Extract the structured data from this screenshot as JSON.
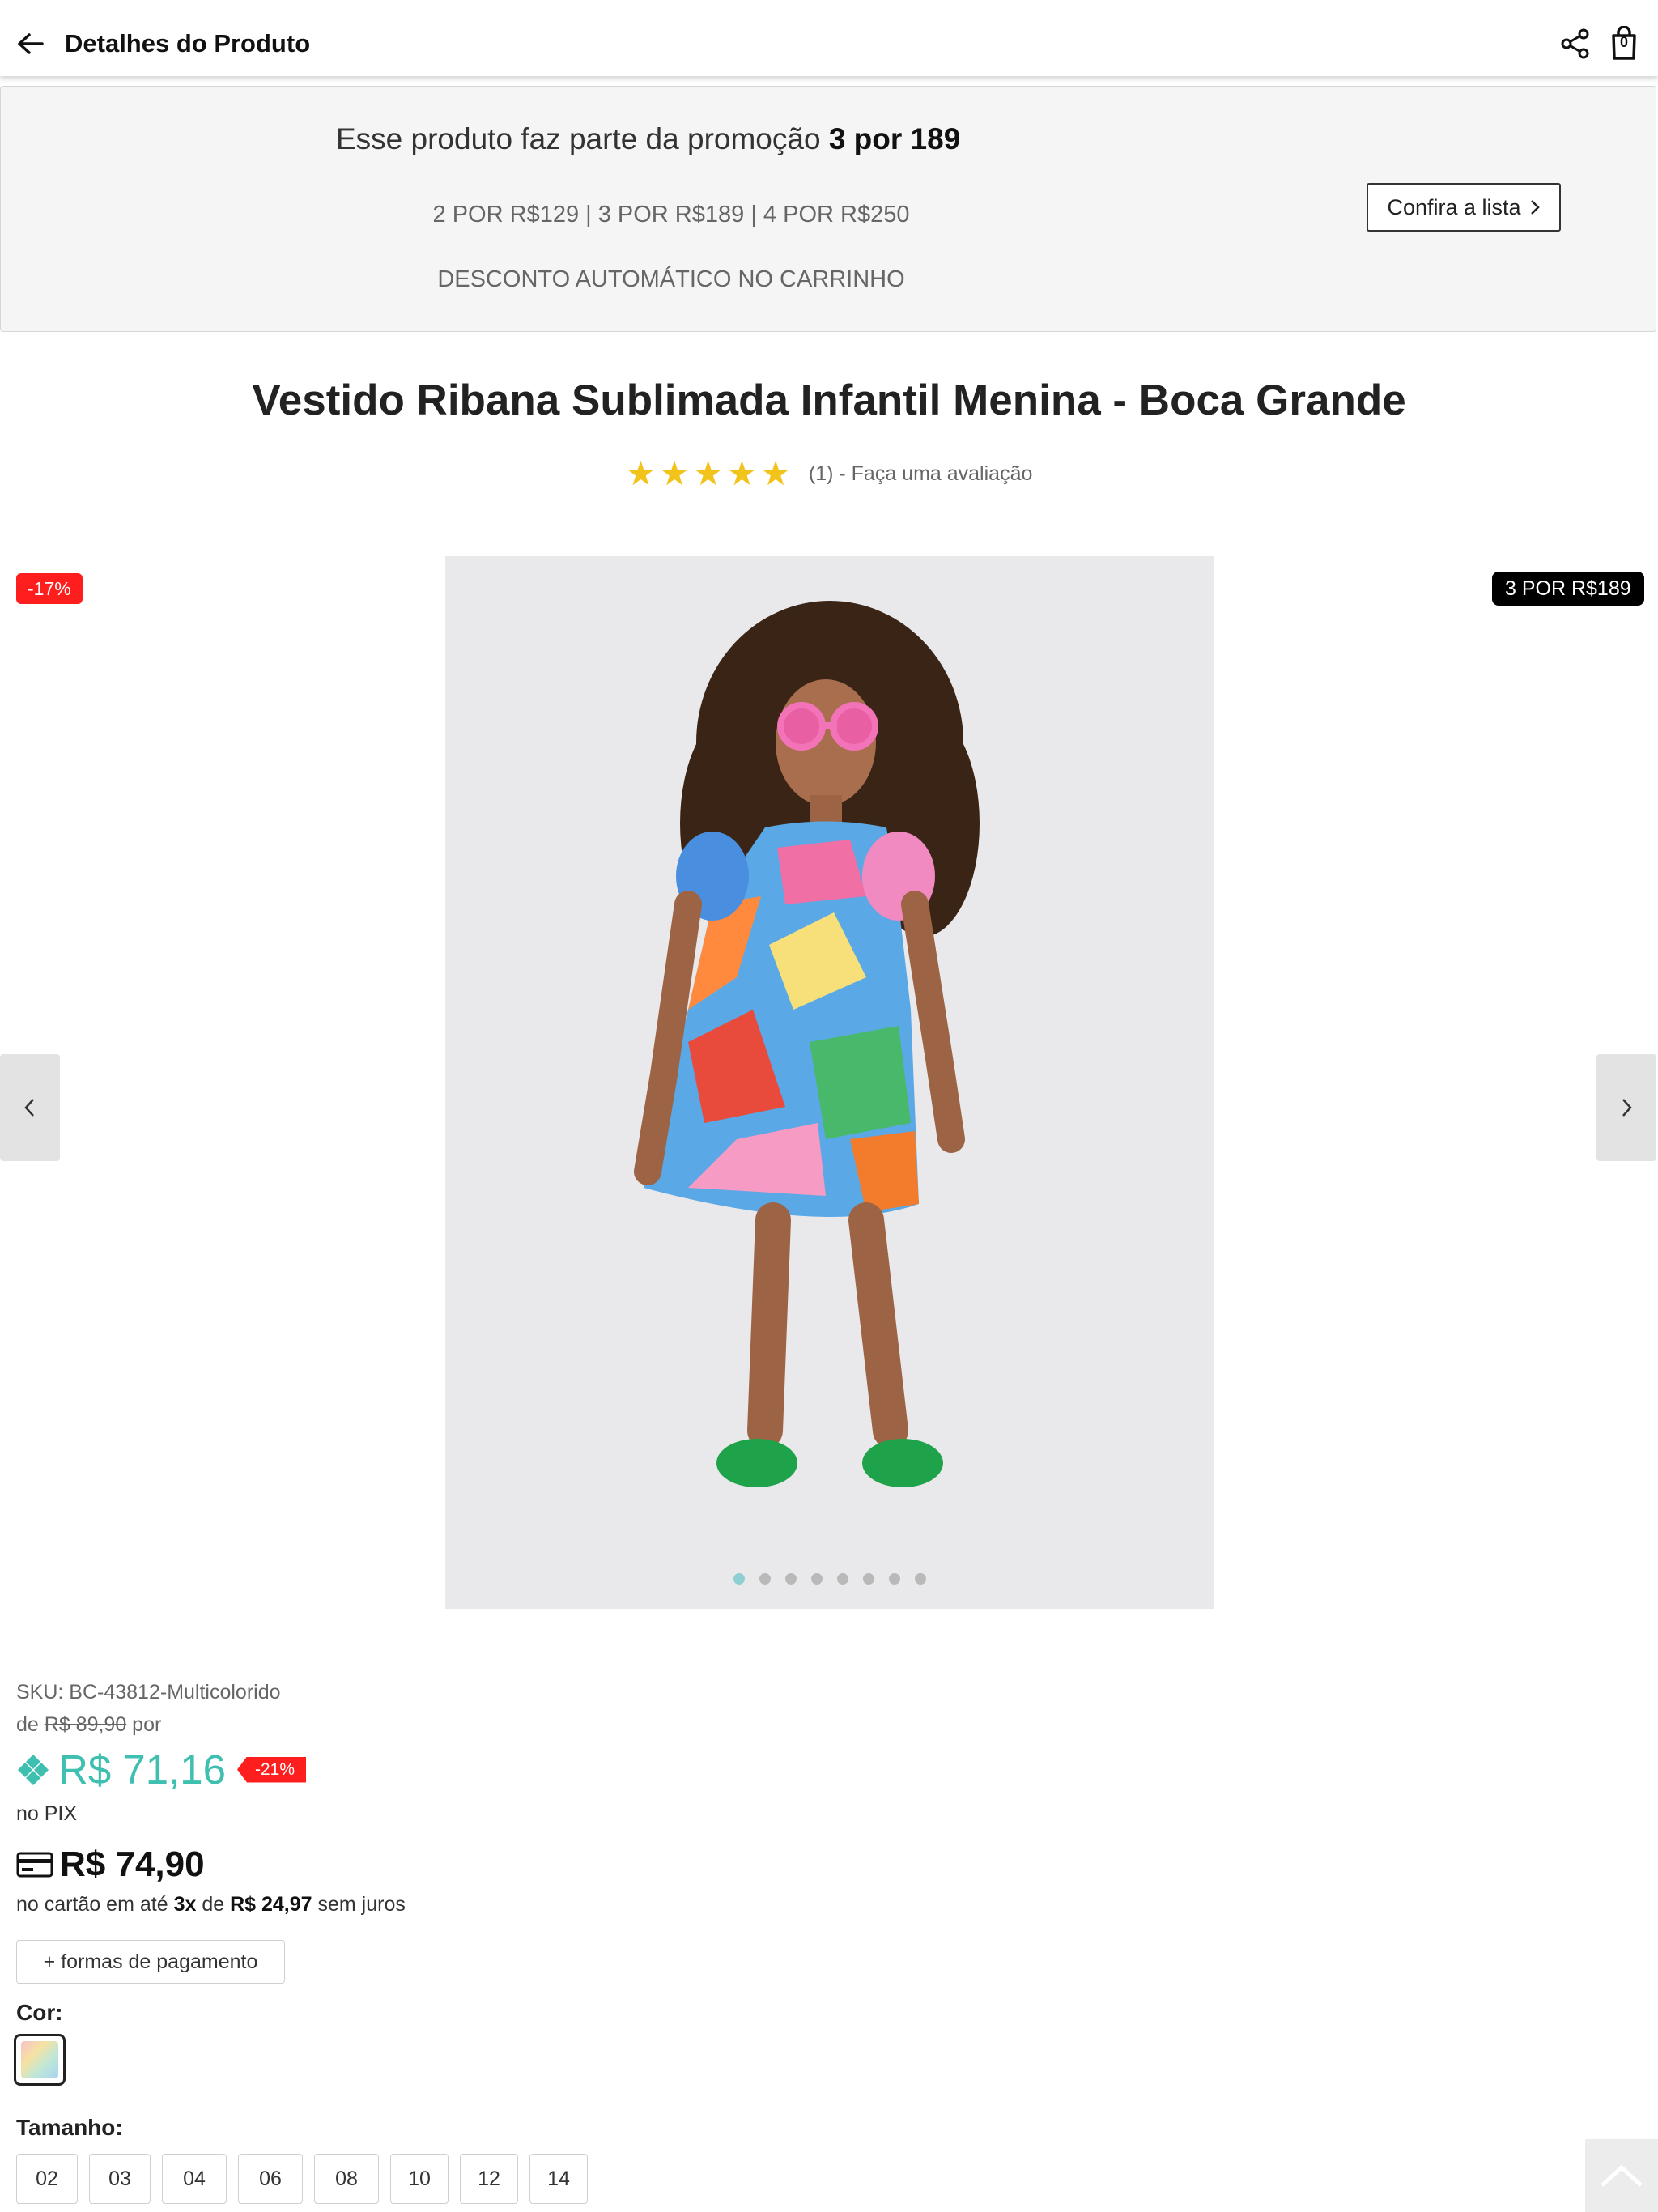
{
  "header": {
    "title": "Detalhes do Produto",
    "bag_count": "0",
    "icons": {
      "back": "arrow-left-icon",
      "share": "share-icon",
      "bag": "shopping-bag-icon"
    }
  },
  "promo": {
    "headline_prefix": "Esse produto faz parte da promoção ",
    "headline_bold": "3 por 189",
    "tiers": "2 POR R$129 | 3 POR R$189 | 4 POR R$250",
    "auto_discount": "DESCONTO AUTOMÁTICO NO CARRINHO",
    "link_label": "Confira a lista"
  },
  "product": {
    "title": "Vestido Ribana Sublimada Infantil Menina - Boca Grande",
    "rating_stars": 5,
    "rating_text": "(1) - Faça uma avaliação"
  },
  "gallery": {
    "discount_badge": "-17%",
    "promo_badge": "3 POR R$189",
    "slide_count": 8,
    "active_slide": 0
  },
  "pricing": {
    "sku": "SKU: BC-43812-Multicolorido",
    "old_prefix": "de ",
    "old_price": "R$ 89,90",
    "old_suffix": " por",
    "pix_price": "R$ 71,16",
    "pix_discount": "-21%",
    "pix_label": "no PIX",
    "card_price": "R$ 74,90",
    "installments_prefix": "no cartão em até ",
    "installments_count": "3x",
    "installments_mid": " de ",
    "installments_value": "R$ 24,97",
    "installments_suffix": " sem juros",
    "payment_button": "+ formas de pagamento"
  },
  "options": {
    "color_label": "Cor:",
    "size_label": "Tamanho:",
    "sizes": [
      "02",
      "03",
      "04",
      "06",
      "08",
      "10",
      "12",
      "14"
    ]
  },
  "colors": {
    "pix": "#3fbfb0",
    "discount": "#ff1e1e",
    "star": "#f2c31a"
  }
}
